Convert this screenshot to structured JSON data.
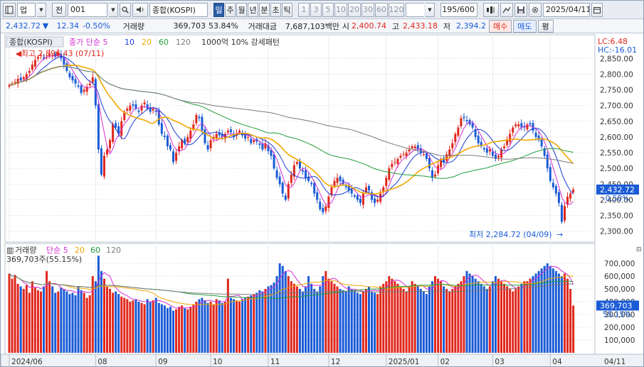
{
  "toolbar": {
    "type_label": "업",
    "period_label": "전",
    "code": "001",
    "search_icon": "magnifier-icon",
    "name_display": "종합(KOSPI)",
    "period_tabs": [
      {
        "label": "일",
        "selected": true
      },
      {
        "label": "주",
        "selected": false
      },
      {
        "label": "월",
        "selected": false
      },
      {
        "label": "년",
        "selected": false
      },
      {
        "label": "분",
        "selected": false
      },
      {
        "label": "초",
        "selected": false
      },
      {
        "label": "틱",
        "selected": false
      }
    ],
    "interval_buttons": [
      "1",
      "3",
      "5",
      "10",
      "20",
      "30",
      "60",
      "120"
    ],
    "count_display": "195/600",
    "date_display": "2025/04/11"
  },
  "quote": {
    "price": "2,432.72",
    "change": "12.34",
    "rate": "-0.50%",
    "volume_label": "거래량",
    "volume": "369,703",
    "volume_ratio": "53.84%",
    "amount_label": "거래대금",
    "amount": "7,687,103백만",
    "open_label": "시",
    "open": "2,400.74",
    "high_label": "고",
    "high": "2,433.18",
    "low_label": "저",
    "low": "2,394.2",
    "buy_label": "매수",
    "sell_label": "매도",
    "eval_label": "평"
  },
  "chart_data": [
    {
      "type": "candlestick",
      "legend": {
        "name": "종합(KOSPI)",
        "series": [
          {
            "name": "종가 단순 5",
            "color": "#d42ed4"
          },
          {
            "name": "10",
            "color": "#1a3bd6"
          },
          {
            "name": "20",
            "color": "#f0a800"
          },
          {
            "name": "60",
            "color": "#1f9e3a"
          },
          {
            "name": "120",
            "color": "#7a7a7a"
          }
        ],
        "extra": "1000억 10% 강세패턴"
      },
      "top_right_label1": "LC:6.48",
      "top_right_label2": "HC:-16.01",
      "ylim": [
        2270,
        2880
      ],
      "y_ticks": [
        2300,
        2350,
        2400,
        2450,
        2500,
        2550,
        2600,
        2650,
        2700,
        2750,
        2800,
        2850
      ],
      "y_tick_labels": [
        "2,300.00",
        "2,350.00",
        "2,400.00",
        "2,450.00",
        "2,500.00",
        "2,550.00",
        "2,600.00",
        "2,650.00",
        "2,700.00",
        "2,750.00",
        "2,800.00",
        "2,850.00"
      ],
      "current_label": "2,432.72",
      "current_rate_label": "-0.50%",
      "current_value": 2432.72,
      "high_annotation": "최고 2,896.43 (07/11)",
      "low_annotation": "최저 2,284.72 (04/09)",
      "high_value": 2896.43,
      "low_value": 2284.72,
      "x_labels": [
        {
          "label": "2024/06",
          "index": 0
        },
        {
          "label": "08",
          "index": 30
        },
        {
          "label": "09",
          "index": 51
        },
        {
          "label": "10",
          "index": 70
        },
        {
          "label": "11",
          "index": 90
        },
        {
          "label": "12",
          "index": 111
        },
        {
          "label": "2025/01",
          "index": 131
        },
        {
          "label": "02",
          "index": 149
        },
        {
          "label": "03",
          "index": 168
        },
        {
          "label": "04",
          "index": 188
        },
        {
          "label": "04/11",
          "index": 207
        }
      ],
      "closes": [
        2765,
        2770,
        2775,
        2785,
        2780,
        2790,
        2800,
        2810,
        2830,
        2845,
        2855,
        2860,
        2850,
        2855,
        2865,
        2860,
        2855,
        2870,
        2850,
        2830,
        2810,
        2790,
        2780,
        2770,
        2760,
        2740,
        2750,
        2760,
        2770,
        2790,
        2700,
        2560,
        2480,
        2540,
        2560,
        2590,
        2640,
        2630,
        2610,
        2650,
        2680,
        2690,
        2700,
        2700,
        2690,
        2680,
        2700,
        2710,
        2690,
        2680,
        2690,
        2680,
        2640,
        2610,
        2600,
        2570,
        2560,
        2520,
        2550,
        2570,
        2590,
        2580,
        2600,
        2620,
        2640,
        2670,
        2660,
        2620,
        2580,
        2560,
        2590,
        2600,
        2610,
        2605,
        2600,
        2610,
        2620,
        2615,
        2600,
        2610,
        2620,
        2605,
        2595,
        2600,
        2580,
        2590,
        2585,
        2575,
        2560,
        2580,
        2555,
        2540,
        2500,
        2470,
        2450,
        2420,
        2400,
        2450,
        2480,
        2510,
        2520,
        2500,
        2490,
        2470,
        2460,
        2450,
        2420,
        2400,
        2370,
        2360,
        2380,
        2410,
        2440,
        2460,
        2470,
        2460,
        2450,
        2440,
        2430,
        2420,
        2410,
        2400,
        2390,
        2420,
        2440,
        2430,
        2400,
        2390,
        2400,
        2420,
        2440,
        2470,
        2500,
        2515,
        2520,
        2530,
        2540,
        2545,
        2550,
        2560,
        2570,
        2570,
        2560,
        2550,
        2545,
        2530,
        2500,
        2470,
        2480,
        2510,
        2530,
        2520,
        2545,
        2560,
        2580,
        2610,
        2630,
        2660,
        2660,
        2650,
        2640,
        2630,
        2600,
        2580,
        2570,
        2560,
        2550,
        2560,
        2540,
        2530,
        2540,
        2560,
        2570,
        2590,
        2610,
        2630,
        2640,
        2640,
        2630,
        2630,
        2640,
        2640,
        2620,
        2600,
        2590,
        2570,
        2540,
        2500,
        2460,
        2440,
        2420,
        2390,
        2330,
        2380,
        2410,
        2420,
        2432.7
      ],
      "ma_lines": [
        "5",
        "10",
        "20",
        "60",
        "120"
      ]
    },
    {
      "type": "bar",
      "legend": {
        "name": "거래량",
        "series": [
          {
            "name": "단순 5",
            "color": "#d42ed4"
          },
          {
            "name": "20",
            "color": "#f0a800"
          },
          {
            "name": "60",
            "color": "#1f9e3a"
          },
          {
            "name": "120",
            "color": "#7a7a7a"
          }
        ]
      },
      "value_annotation": "369,703주(55.15%)",
      "ylim": [
        0,
        800000
      ],
      "y_ticks": [
        100000,
        200000,
        300000,
        400000,
        500000,
        600000,
        700000
      ],
      "y_tick_labels": [
        "100,000",
        "200,000",
        "300,000",
        "400,000",
        "500,000",
        "600,000",
        "700,000"
      ],
      "current_label": "369,703",
      "current_rate_label": "55.15%",
      "current_value": 369703,
      "volumes": [
        620,
        580,
        610,
        540,
        520,
        500,
        530,
        470,
        560,
        510,
        490,
        480,
        520,
        640,
        560,
        520,
        470,
        480,
        510,
        500,
        480,
        460,
        470,
        450,
        520,
        490,
        470,
        430,
        450,
        600,
        560,
        760,
        640,
        580,
        520,
        500,
        470,
        480,
        460,
        440,
        430,
        420,
        400,
        410,
        420,
        400,
        390,
        380,
        420,
        400,
        410,
        430,
        390,
        380,
        370,
        350,
        360,
        330,
        340,
        360,
        370,
        350,
        340,
        360,
        380,
        400,
        420,
        430,
        410,
        390,
        400,
        380,
        420,
        410,
        390,
        400,
        580,
        430,
        420,
        410,
        400,
        420,
        430,
        440,
        450,
        460,
        470,
        490,
        480,
        500,
        520,
        530,
        550,
        600,
        700,
        680,
        640,
        600,
        560,
        540,
        520,
        500,
        480,
        520,
        600,
        540,
        500,
        480,
        520,
        600,
        640,
        580,
        560,
        540,
        520,
        500,
        490,
        480,
        520,
        500,
        490,
        470,
        460,
        480,
        500,
        520,
        480,
        470,
        460,
        520,
        540,
        560,
        600,
        580,
        560,
        540,
        520,
        500,
        480,
        520,
        560,
        540,
        520,
        500,
        480,
        460,
        520,
        560,
        600,
        580,
        560,
        520,
        500,
        480,
        500,
        520,
        540,
        560,
        600,
        640,
        620,
        600,
        580,
        560,
        540,
        520,
        500,
        520,
        560,
        600,
        580,
        560,
        540,
        520,
        500,
        480,
        500,
        520,
        540,
        560,
        560,
        580,
        600,
        620,
        640,
        660,
        680,
        700,
        680,
        660,
        640,
        620,
        600,
        620,
        580,
        500,
        370
      ]
    }
  ]
}
